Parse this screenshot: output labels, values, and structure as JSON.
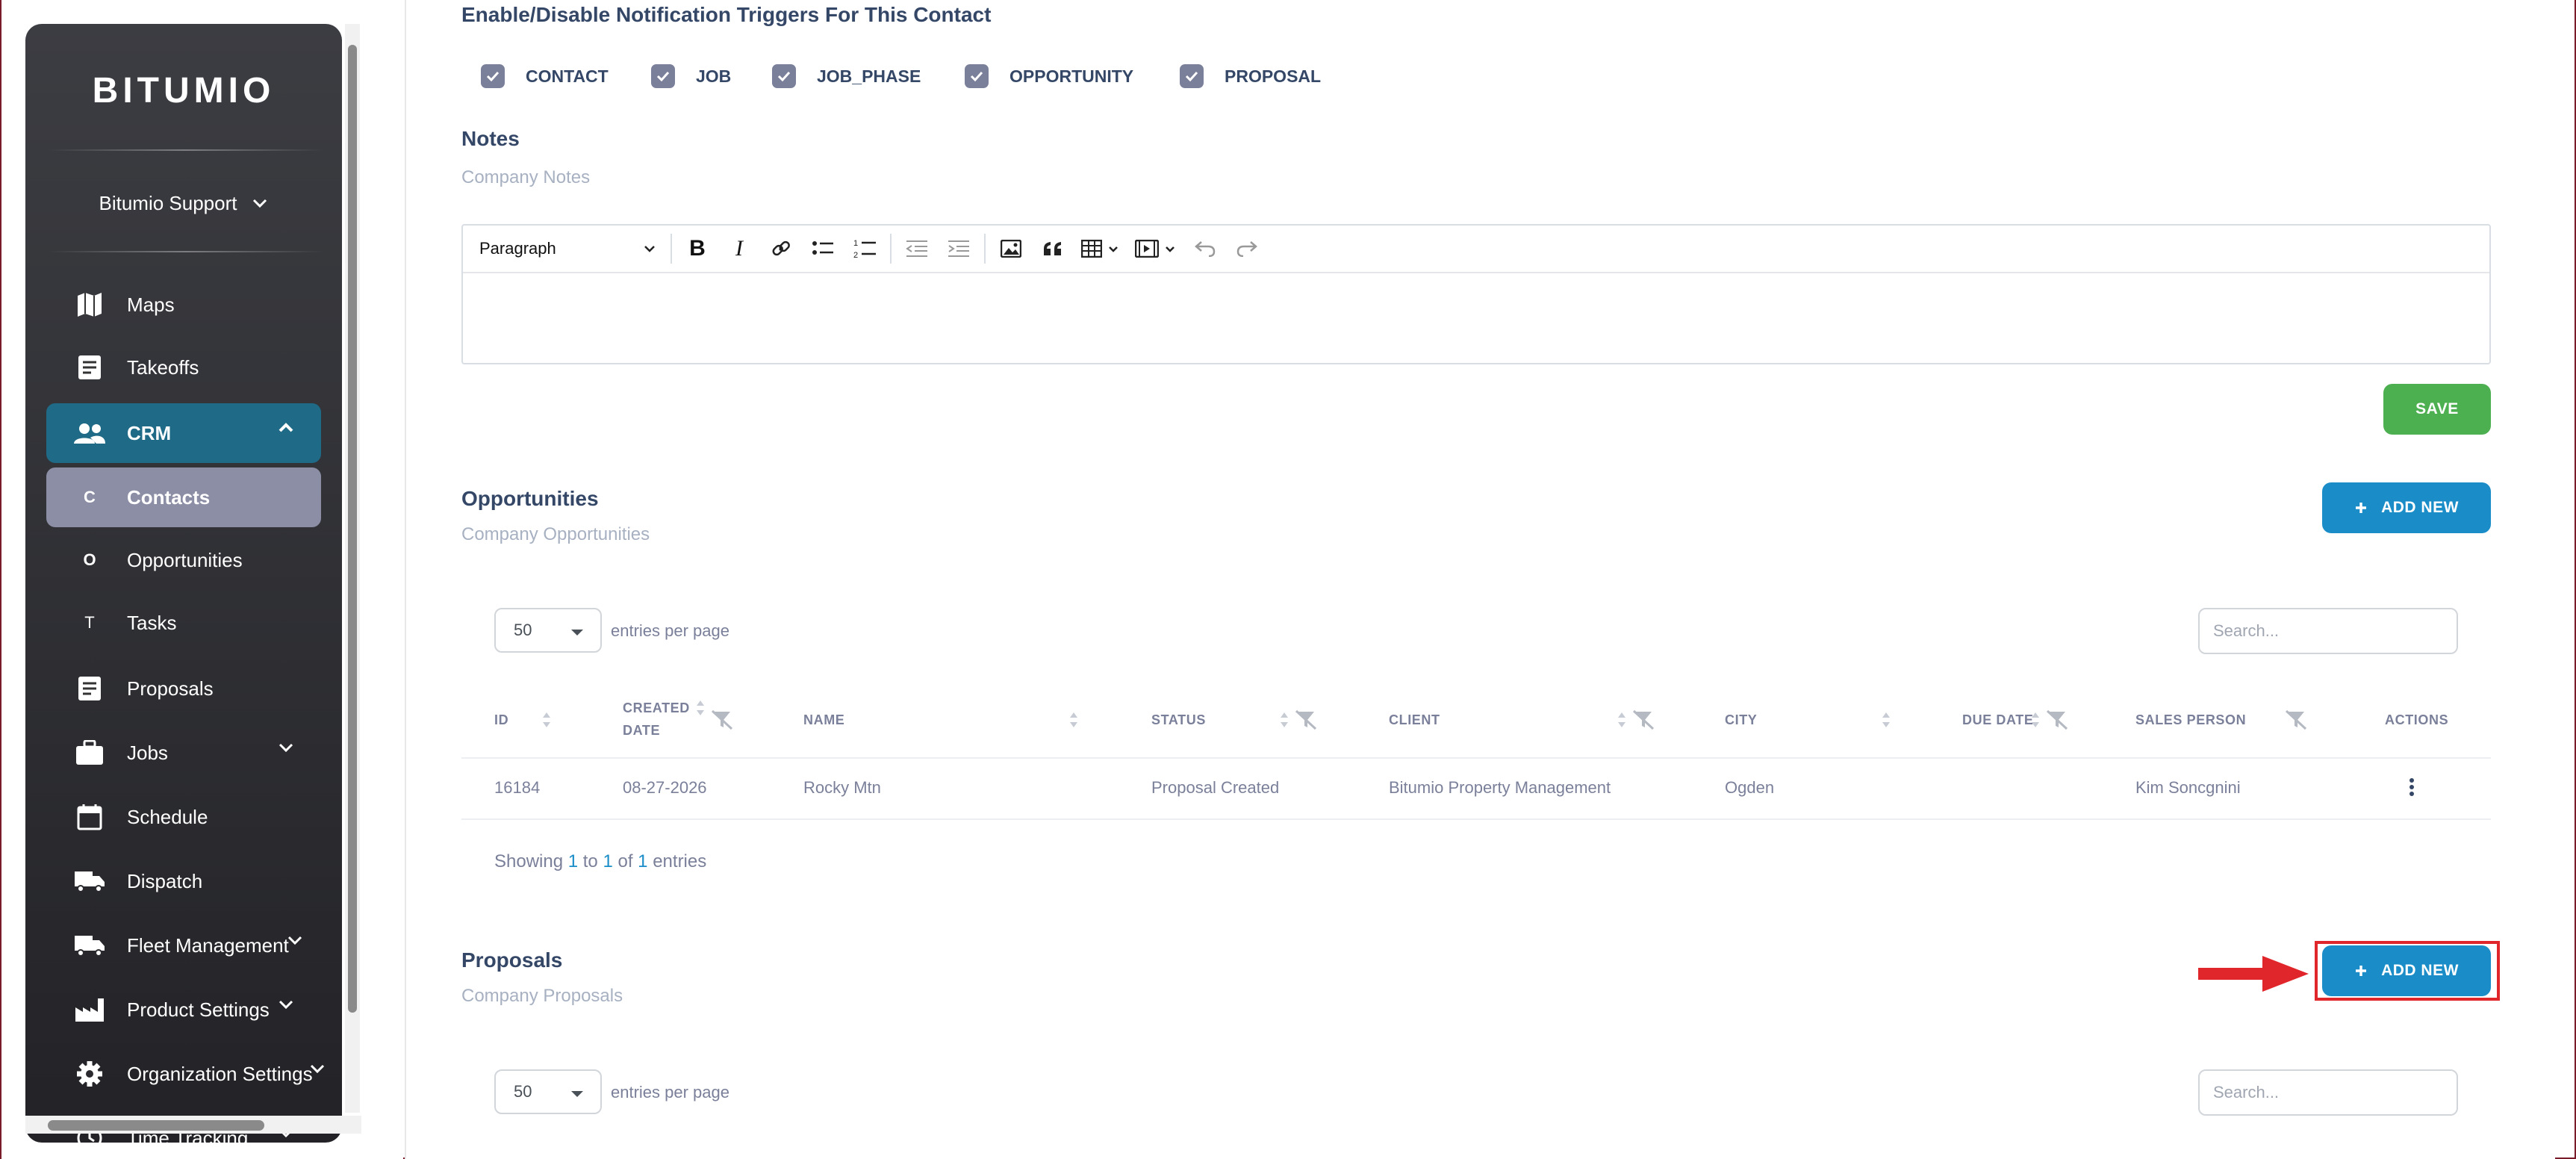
{
  "sidebar": {
    "logo": "BITUMIO",
    "user": "Bitumio Support",
    "items": [
      {
        "label": "Maps",
        "icon": "map-icon"
      },
      {
        "label": "Takeoffs",
        "icon": "document-icon"
      },
      {
        "label": "CRM",
        "icon": "people-icon"
      },
      {
        "label": "Contacts",
        "letter": "C"
      },
      {
        "label": "Opportunities",
        "letter": "O"
      },
      {
        "label": "Tasks",
        "letter": "T"
      },
      {
        "label": "Proposals",
        "icon": "document-icon"
      },
      {
        "label": "Jobs",
        "icon": "briefcase-icon"
      },
      {
        "label": "Schedule",
        "icon": "calendar-icon"
      },
      {
        "label": "Dispatch",
        "icon": "truck-icon"
      },
      {
        "label": "Fleet Management",
        "icon": "truck-icon"
      },
      {
        "label": "Product Settings",
        "icon": "factory-icon"
      },
      {
        "label": "Organization Settings",
        "icon": "gear-icon"
      },
      {
        "label": "Time Tracking",
        "icon": "clock-icon"
      }
    ]
  },
  "notifications": {
    "title": "Enable/Disable Notification Triggers For This Contact",
    "triggers": [
      "CONTACT",
      "JOB",
      "JOB_PHASE",
      "OPPORTUNITY",
      "PROPOSAL"
    ]
  },
  "notes": {
    "title": "Notes",
    "subtitle": "Company Notes",
    "paragraph_label": "Paragraph",
    "save_label": "SAVE"
  },
  "opportunities": {
    "title": "Opportunities",
    "subtitle": "Company Opportunities",
    "add_label": "ADD NEW",
    "entries_value": "50",
    "entries_label": "entries per page",
    "search_placeholder": "Search...",
    "columns": [
      "ID",
      "CREATED",
      "DATE",
      "NAME",
      "STATUS",
      "CLIENT",
      "CITY",
      "DUE DATE",
      "SALES PERSON",
      "ACTIONS"
    ],
    "rows": [
      {
        "id": "16184",
        "created": "08-27-2026",
        "name": "Rocky Mtn",
        "status": "Proposal Created",
        "client": "Bitumio Property Management",
        "city": "Ogden",
        "due": "",
        "sales": "Kim Soncgnini"
      }
    ],
    "showing": {
      "prefix": "Showing",
      "from": "1",
      "to_word": "to",
      "to": "1",
      "of_word": "of",
      "total": "1",
      "suffix": "entries"
    }
  },
  "proposals": {
    "title": "Proposals",
    "subtitle": "Company Proposals",
    "add_label": "ADD NEW",
    "entries_value": "50",
    "entries_label": "entries per page",
    "search_placeholder": "Search..."
  },
  "colors": {
    "accent": "#1a8dc8",
    "save": "#4caf50",
    "highlight": "#e0262b",
    "crm_bg": "#1f6a86"
  }
}
